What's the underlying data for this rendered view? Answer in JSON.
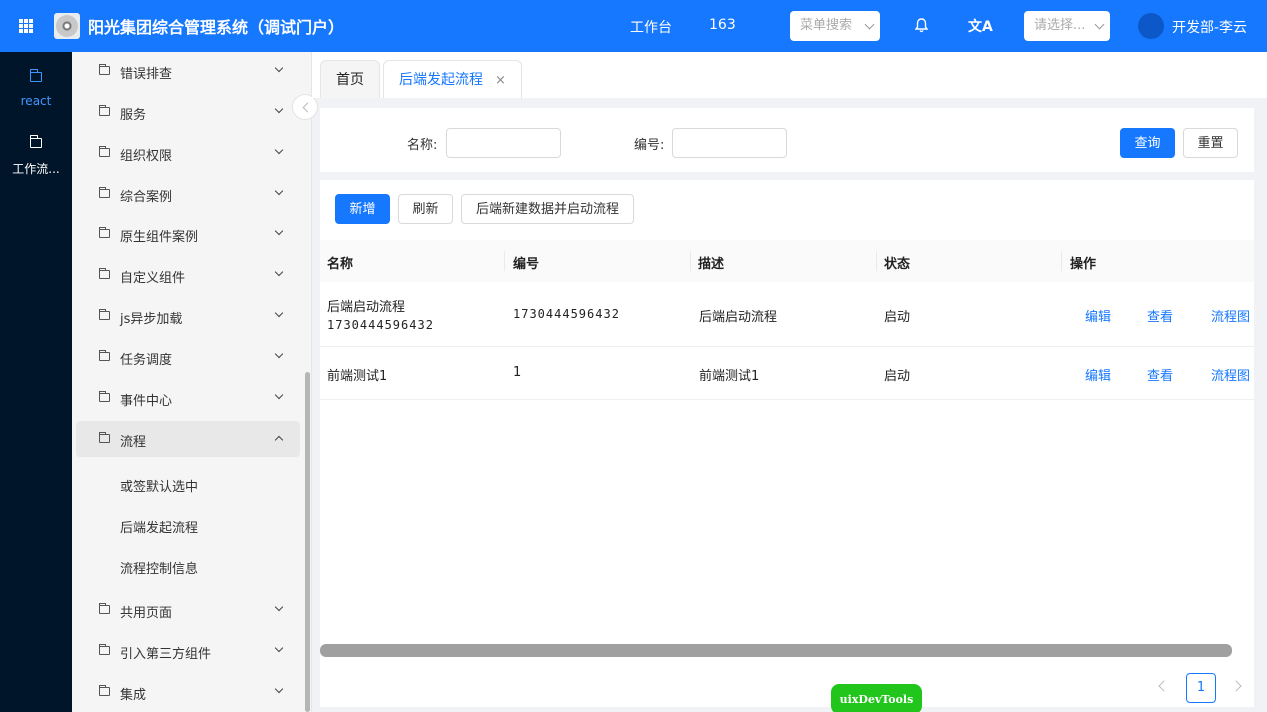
{
  "header": {
    "title": "阳光集团综合管理系统（调试门户）",
    "workbench": "工作台",
    "count": "163",
    "menu_search_placeholder": "菜单搜索",
    "select_placeholder": "请选择...",
    "user": "开发部-李云",
    "translate_glyph": "文A",
    "colors": {
      "primary": "#1677ff",
      "rail": "#001529"
    }
  },
  "rail": [
    {
      "label": "react",
      "icon": "folder-icon"
    },
    {
      "label": "工作流...",
      "icon": "folder-icon"
    }
  ],
  "sidemenu": {
    "items_top": [
      "错误排查",
      "服务",
      "组织权限",
      "综合案例",
      "原生组件案例",
      "自定义组件",
      "js异步加载",
      "任务调度",
      "事件中心"
    ],
    "open_item": "流程",
    "sub_items": [
      "或签默认选中",
      "后端发起流程",
      "流程控制信息"
    ],
    "items_bottom": [
      "共用页面",
      "引入第三方组件",
      "集成"
    ]
  },
  "tabs": [
    {
      "label": "首页"
    },
    {
      "label": "后端发起流程",
      "close": "×"
    }
  ],
  "search": {
    "name_label": "名称:",
    "code_label": "编号:",
    "query": "查询",
    "reset": "重置"
  },
  "toolbar": {
    "add": "新增",
    "refresh": "刷新",
    "create_start": "后端新建数据并启动流程"
  },
  "table": {
    "columns": [
      "名称",
      "编号",
      "描述",
      "状态",
      "操作"
    ],
    "rows": [
      {
        "name": "后端启动流程",
        "name_sub": "1730444596432",
        "code": "1730444596432",
        "desc": "后端启动流程",
        "status": "启动"
      },
      {
        "name": "前端测试1",
        "name_sub": "",
        "code": "1",
        "desc": "前端测试1",
        "status": "启动"
      }
    ],
    "actions": [
      "编辑",
      "查看",
      "流程图"
    ]
  },
  "pagination": {
    "current": "1"
  },
  "devtools": "uixDevTools"
}
